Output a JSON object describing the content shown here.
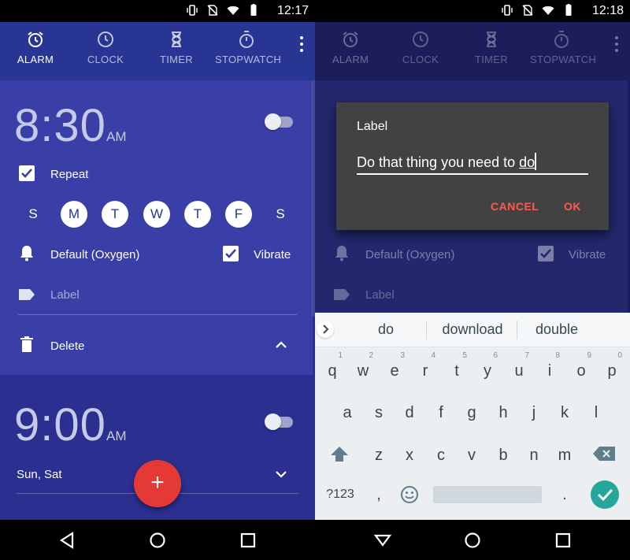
{
  "status_left": {
    "time": "12:17"
  },
  "status_right": {
    "time": "12:18"
  },
  "tabs": [
    {
      "label": "ALARM"
    },
    {
      "label": "CLOCK"
    },
    {
      "label": "TIMER"
    },
    {
      "label": "STOPWATCH"
    }
  ],
  "alarm1": {
    "time": "8:30",
    "ampm": "AM",
    "repeat_label": "Repeat",
    "days": [
      "S",
      "M",
      "T",
      "W",
      "T",
      "F",
      "S"
    ],
    "ringtone": "Default (Oxygen)",
    "vibrate_label": "Vibrate",
    "label_placeholder": "Label",
    "delete_label": "Delete"
  },
  "alarm2": {
    "time": "9:00",
    "ampm": "AM",
    "days_summary": "Sun, Sat"
  },
  "fab_symbol": "+",
  "dialog": {
    "title": "Label",
    "value_prefix": "Do that thing you need to ",
    "value_current_word": "do",
    "cancel_label": "CANCEL",
    "ok_label": "OK"
  },
  "keyboard": {
    "suggestions": [
      "do",
      "download",
      "double"
    ],
    "row1": [
      "q",
      "w",
      "e",
      "r",
      "t",
      "y",
      "u",
      "i",
      "o",
      "p"
    ],
    "row1_hints": [
      "1",
      "2",
      "3",
      "4",
      "5",
      "6",
      "7",
      "8",
      "9",
      "0"
    ],
    "row2": [
      "a",
      "s",
      "d",
      "f",
      "g",
      "h",
      "j",
      "k",
      "l"
    ],
    "row3": [
      "z",
      "x",
      "c",
      "v",
      "b",
      "n",
      "m"
    ],
    "symbols_key": "?123",
    "comma_key": ",",
    "period_key": "."
  },
  "colors": {
    "accent": "#e53935",
    "dialog_button": "#ff5a4e",
    "primary": "#283593",
    "enter_key": "#26a69a"
  }
}
